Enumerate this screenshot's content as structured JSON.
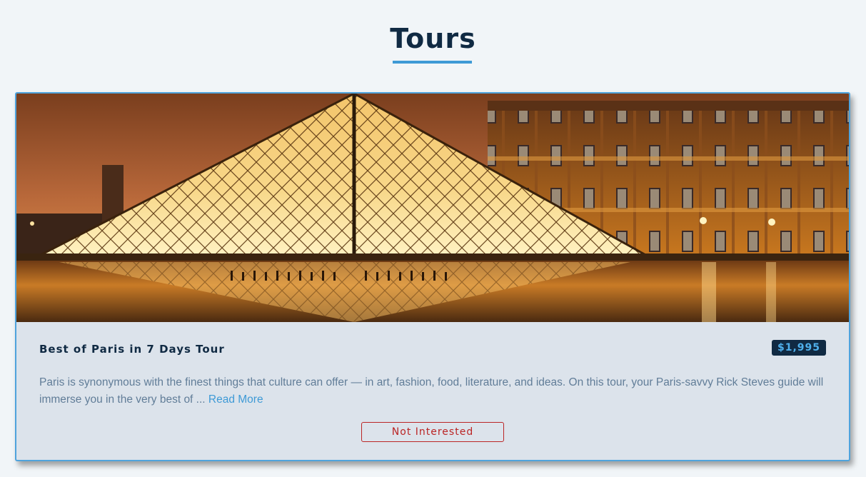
{
  "page": {
    "title": "Tours"
  },
  "tour": {
    "name": "Best of Paris in 7 Days Tour",
    "price": "$1,995",
    "description": "Paris is synonymous with the finest things that culture can offer — in art, fashion, food, literature, and ideas. On this tour, your Paris-savvy Rick Steves guide will immerse you in the very best of ... ",
    "read_more_label": "Read More",
    "not_interested_label": "Not Interested"
  },
  "colors": {
    "accent": "#3e9ad6",
    "title": "#102a43",
    "danger": "#bb2525",
    "card_bg": "#dce3eb"
  }
}
